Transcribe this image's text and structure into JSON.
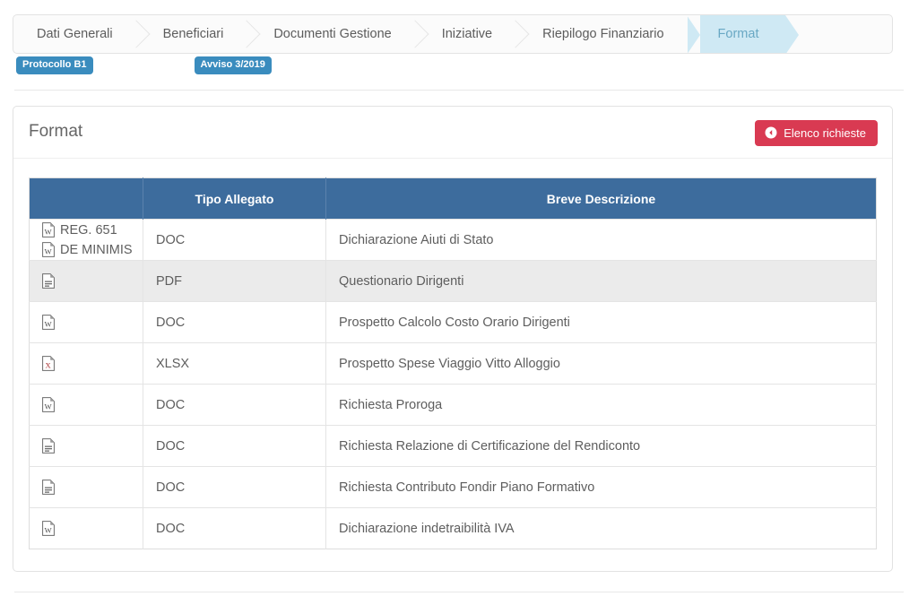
{
  "wizard": {
    "steps": [
      {
        "label": "Dati Generali",
        "active": false
      },
      {
        "label": "Beneficiari",
        "active": false
      },
      {
        "label": "Documenti Gestione",
        "active": false
      },
      {
        "label": "Iniziative",
        "active": false
      },
      {
        "label": "Riepilogo Finanziario",
        "active": false
      },
      {
        "label": "Format",
        "active": true
      }
    ]
  },
  "badges": [
    {
      "label": "Protocollo B1"
    },
    {
      "label": "Avviso 3/2019"
    }
  ],
  "panel": {
    "title": "Format",
    "back_button": {
      "label": "Elenco richieste",
      "icon": "circle-arrow-left-icon",
      "color": "#d93a52"
    }
  },
  "table": {
    "columns": [
      {
        "header": ""
      },
      {
        "header": "Tipo Allegato"
      },
      {
        "header": "Breve Descrizione"
      }
    ],
    "header_color": "#3d6c9d",
    "rows": [
      {
        "icons": [
          {
            "type": "word-file-icon",
            "label": "REG. 651"
          },
          {
            "type": "word-file-icon",
            "label": "DE MINIMIS"
          }
        ],
        "tipo": "DOC",
        "descrizione": "Dichiarazione Aiuti di Stato",
        "shaded": false
      },
      {
        "icons": [
          {
            "type": "generic-file-icon",
            "label": ""
          }
        ],
        "tipo": "PDF",
        "descrizione": "Questionario Dirigenti",
        "shaded": true
      },
      {
        "icons": [
          {
            "type": "word-file-icon",
            "label": ""
          }
        ],
        "tipo": "DOC",
        "descrizione": "Prospetto Calcolo Costo Orario Dirigenti",
        "shaded": false
      },
      {
        "icons": [
          {
            "type": "excel-file-icon",
            "label": ""
          }
        ],
        "tipo": "XLSX",
        "descrizione": "Prospetto Spese Viaggio Vitto Alloggio",
        "shaded": false
      },
      {
        "icons": [
          {
            "type": "word-file-icon",
            "label": ""
          }
        ],
        "tipo": "DOC",
        "descrizione": "Richiesta Proroga",
        "shaded": false
      },
      {
        "icons": [
          {
            "type": "generic-file-icon",
            "label": ""
          }
        ],
        "tipo": "DOC",
        "descrizione": "Richiesta Relazione di Certificazione del Rendiconto",
        "shaded": false
      },
      {
        "icons": [
          {
            "type": "generic-file-icon",
            "label": ""
          }
        ],
        "tipo": "DOC",
        "descrizione": "Richiesta Contributo Fondir Piano Formativo",
        "shaded": false
      },
      {
        "icons": [
          {
            "type": "word-file-icon",
            "label": ""
          }
        ],
        "tipo": "DOC",
        "descrizione": "Dichiarazione indetraibilità IVA",
        "shaded": false
      }
    ]
  }
}
